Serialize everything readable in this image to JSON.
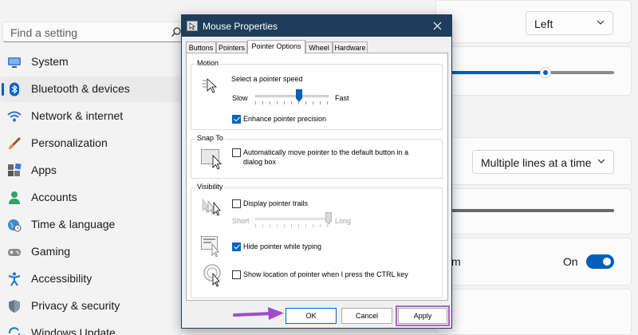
{
  "settings": {
    "search": {
      "placeholder": "Find a setting"
    },
    "nav": [
      {
        "label": "System",
        "icon": "monitor-icon"
      },
      {
        "label": "Bluetooth & devices",
        "icon": "bluetooth-icon",
        "active": true
      },
      {
        "label": "Network & internet",
        "icon": "wifi-icon"
      },
      {
        "label": "Personalization",
        "icon": "brush-icon"
      },
      {
        "label": "Apps",
        "icon": "apps-icon"
      },
      {
        "label": "Accounts",
        "icon": "person-icon"
      },
      {
        "label": "Time & language",
        "icon": "globe-clock-icon"
      },
      {
        "label": "Gaming",
        "icon": "gamepad-icon"
      },
      {
        "label": "Accessibility",
        "icon": "accessibility-icon"
      },
      {
        "label": "Privacy & security",
        "icon": "shield-icon"
      },
      {
        "label": "Windows Update",
        "icon": "update-icon"
      }
    ],
    "primary_button": {
      "value": "Left"
    },
    "scroll_lines": {
      "value": "Multiple lines at a time"
    },
    "inactive_scroll": {
      "state": "On",
      "on": true
    },
    "sliver_text": "m",
    "accent_color": "#005fb8"
  },
  "dialog": {
    "title": "Mouse Properties",
    "tabs": [
      "Buttons",
      "Pointers",
      "Pointer Options",
      "Wheel",
      "Hardware"
    ],
    "selected_tab": "Pointer Options",
    "motion": {
      "group": "Motion",
      "label": "Select a pointer speed",
      "slow": "Slow",
      "fast": "Fast",
      "speed_fraction": 0.6,
      "enhance": {
        "label": "Enhance pointer precision",
        "checked": true
      }
    },
    "snap": {
      "group": "Snap To",
      "label_line1": "Automatically move pointer to the default button in a",
      "label_line2": "dialog box",
      "checked": false
    },
    "visibility": {
      "group": "Visibility",
      "trails": {
        "label": "Display pointer trails",
        "checked": false
      },
      "short": "Short",
      "long": "Long",
      "trail_fraction": 1.0,
      "hide": {
        "label": "Hide pointer while typing",
        "checked": true
      },
      "ctrl": {
        "label": "Show location of pointer when I press the CTRL key",
        "checked": false
      }
    },
    "buttons": {
      "ok": "OK",
      "cancel": "Cancel",
      "apply": "Apply"
    },
    "title_color": "#1e3d5c",
    "highlight_color": "#b061d4"
  }
}
